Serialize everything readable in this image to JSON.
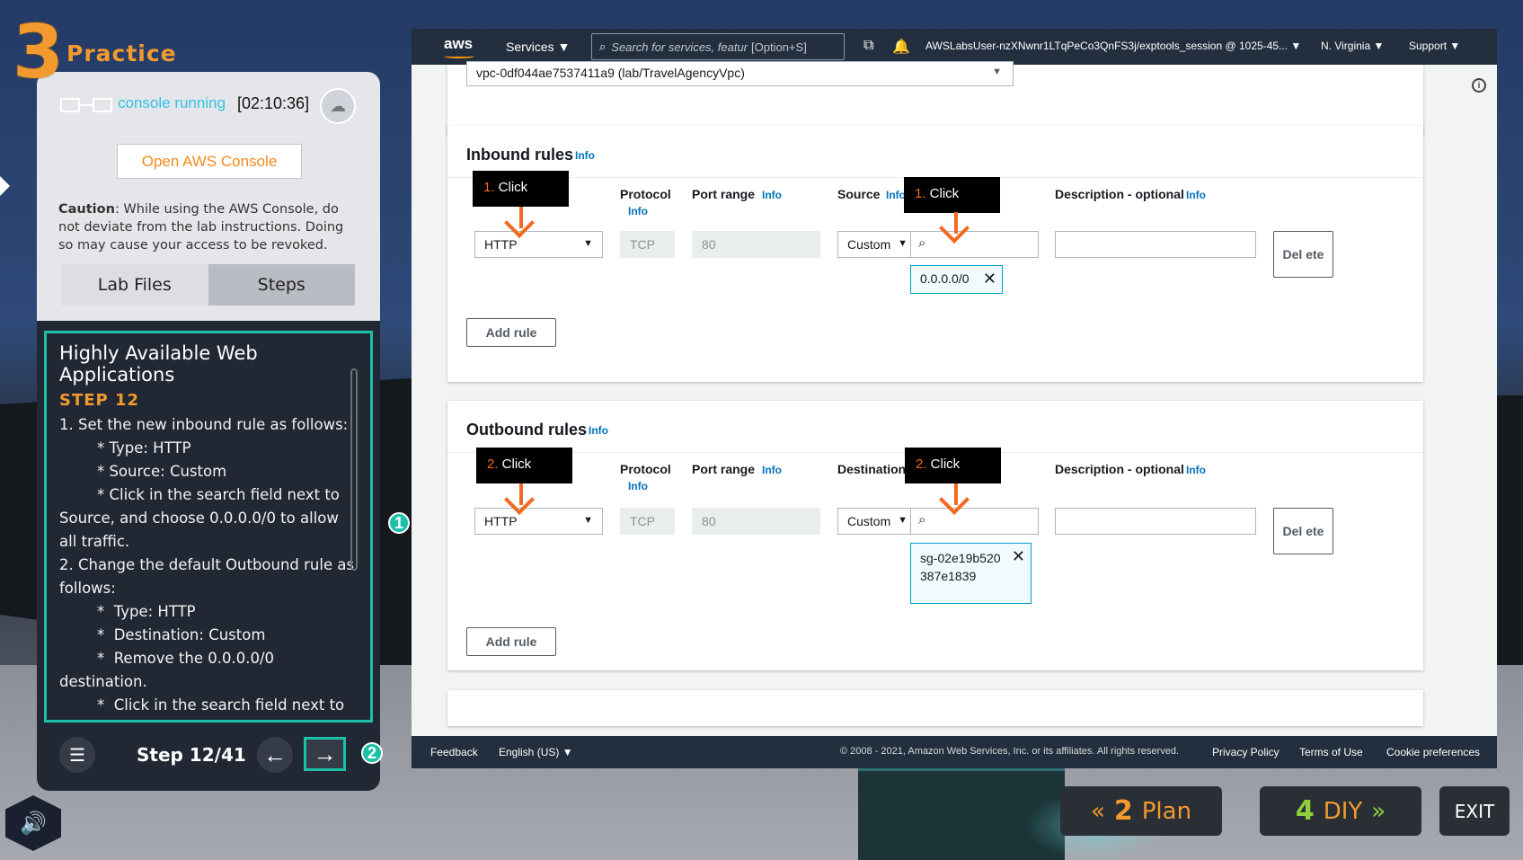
{
  "practice": {
    "step_number": "3",
    "title": "Practice",
    "console_status": "console running",
    "timer": "[02:10:36]",
    "open_console_label": "Open AWS Console",
    "caution_label": "Caution",
    "caution_text": ": While using the AWS Console, do not deviate from the lab instructions. Doing so may cause your access to be revoked.",
    "tabs": [
      {
        "label": "Lab Files"
      },
      {
        "label": "Steps"
      }
    ]
  },
  "instructions": {
    "title": "Highly Available Web Applications",
    "step": "STEP 12",
    "lines": [
      "1. Set the new inbound rule as follows:",
      "        * Type: HTTP",
      "        * Source: Custom",
      "        * Click in the search field next to Source, and choose 0.0.0.0/0 to allow all traffic.",
      "2. Change the default Outbound rule as follows:",
      "        *  Type: HTTP",
      "        *  Destination: Custom",
      "        *  Remove the 0.0.0.0/0 destination.",
      "        *  Click in the search field next to Destination, and select the"
    ]
  },
  "badges": {
    "one": "1",
    "two": "2"
  },
  "nav": {
    "step_counter": "Step 12/41",
    "prev_icon": "←",
    "next_icon": "→",
    "menu_icon": "☰"
  },
  "aws_nav": {
    "logo": "aws",
    "services": "Services ▼",
    "search_placeholder": "Search for services, featur",
    "search_shortcut": "[Option+S]",
    "user": "AWSLabsUser-nzXNwnr1LTqPeCo3QnFS3j/exptools_session @ 1025-45... ▼",
    "region": "N. Virginia ▼",
    "support": "Support ▼"
  },
  "vpc": {
    "value": "vpc-0df044ae7537411a9 (lab/TravelAgencyVpc)"
  },
  "inbound": {
    "title": "Inbound rules",
    "info": "Info",
    "headers": {
      "protocol": "Protocol",
      "port_range": "Port range",
      "source": "Source",
      "description": "Description - optional"
    },
    "type_value": "HTTP",
    "protocol_value": "TCP",
    "port_value": "80",
    "source_type": "Custom",
    "token": "0.0.0.0/0",
    "delete_label": "Del ete",
    "add_rule": "Add rule",
    "callout_type": {
      "num": "1.",
      "label": " Click"
    },
    "callout_source": {
      "num": "1.",
      "label": " Click"
    }
  },
  "outbound": {
    "title": "Outbound rules",
    "info": "Info",
    "headers": {
      "protocol": "Protocol",
      "port_range": "Port range",
      "destination": "Destination",
      "description": "Description - optional"
    },
    "type_value": "HTTP",
    "protocol_value": "TCP",
    "port_value": "80",
    "dest_type": "Custom",
    "token": "sg-02e19b520387e1839",
    "delete_label": "Del ete",
    "add_rule": "Add rule",
    "callout_type": {
      "num": "2.",
      "label": " Click"
    },
    "callout_dest": {
      "num": "2.",
      "label": " Click"
    }
  },
  "footer": {
    "feedback": "Feedback",
    "language": "English (US) ▼",
    "copyright": "© 2008 - 2021, Amazon Web Services, Inc. or its affiliates. All rights reserved.",
    "privacy": "Privacy Policy",
    "terms": "Terms of Use",
    "cookies": "Cookie preferences"
  },
  "bottom_buttons": {
    "plan_num": "2",
    "plan_label": "Plan",
    "diy_num": "4",
    "diy_label": "DIY",
    "exit_label": "EXIT"
  },
  "colors": {
    "accent_orange": "#f29a2e",
    "teal": "#1cc0a8",
    "aws_nav": "#232f3e",
    "callout_orange": "#f26a21"
  }
}
